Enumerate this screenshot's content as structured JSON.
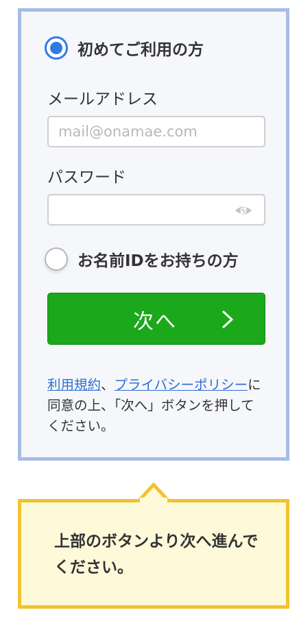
{
  "form": {
    "new_user_label": "初めてご利用の方",
    "email_label": "メールアドレス",
    "email_placeholder": "mail@onamae.com",
    "email_value": "",
    "password_label": "パスワード",
    "password_value": "",
    "existing_user_label": "お名前IDをお持ちの方",
    "next_button_label": "次へ",
    "selected_option": "初めてご利用の方"
  },
  "terms": {
    "link_terms": "利用規約",
    "sep": "、",
    "link_privacy": "プライバシーポリシー",
    "text": "に同意の上、「次へ」ボタンを押してください。"
  },
  "callout": {
    "text": "上部のボタンより次へ進んでください。"
  },
  "icons": {
    "chevron": "chevron-right-icon",
    "eye": "eye-icon"
  },
  "colors": {
    "radio_accent": "#2e7be6",
    "button_green": "#1ba81b",
    "card_border": "#a7bce6",
    "callout_border": "#f2c231",
    "callout_bg": "#fef9d9",
    "link": "#2e6fd3"
  }
}
